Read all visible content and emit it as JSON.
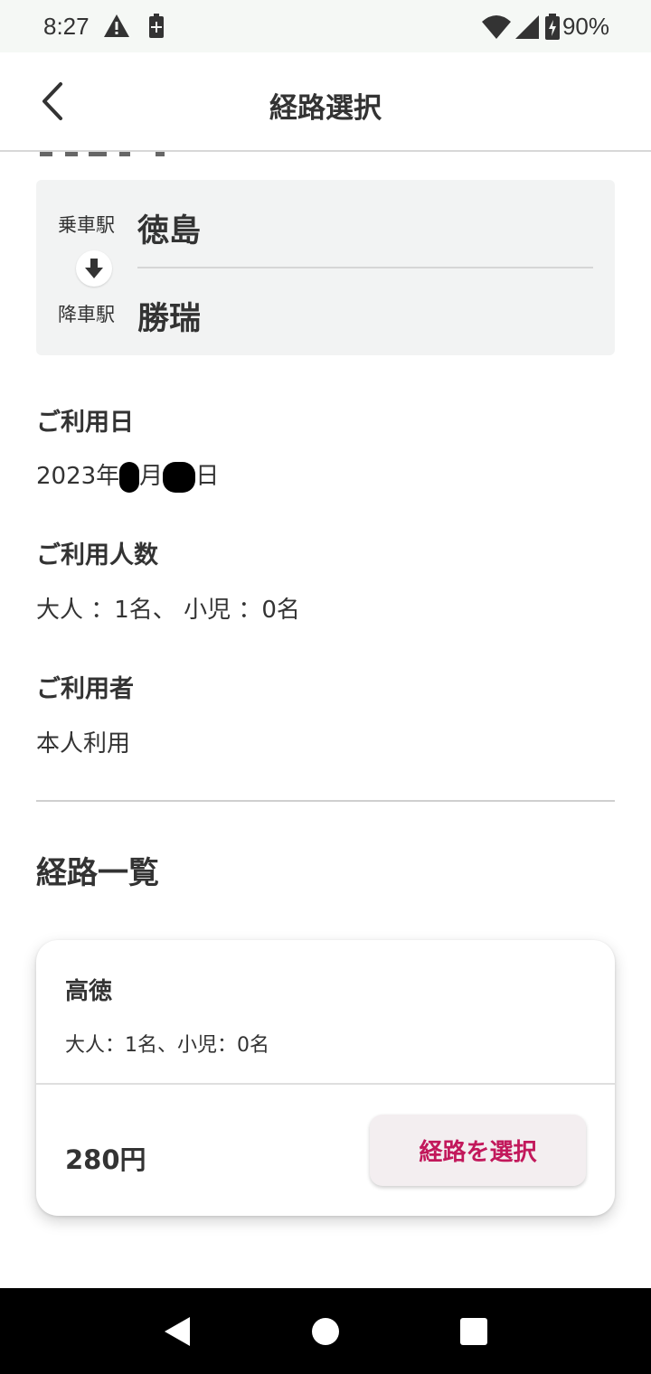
{
  "status_bar": {
    "time": "8:27",
    "battery_percent": "90%",
    "icons": [
      "warning-icon",
      "battery-saver-icon",
      "wifi-icon",
      "cell-signal-icon",
      "battery-charging-icon"
    ]
  },
  "app_bar": {
    "title": "経路選択",
    "back_icon": "chevron-left-icon"
  },
  "stations": {
    "boarding_label": "乗車駅",
    "boarding_name": "徳島",
    "alighting_label": "降車駅",
    "alighting_name": "勝瑞",
    "arrow_icon": "arrow-down-icon"
  },
  "usage_date": {
    "title": "ご利用日",
    "year_text": "2023年",
    "month_suffix": "月",
    "day_suffix": "日"
  },
  "passengers": {
    "title": "ご利用人数",
    "value": "大人 ：1名、 小児 ：0名"
  },
  "user": {
    "title": "ご利用者",
    "value": "本人利用"
  },
  "route_list": {
    "title": "経路一覧",
    "routes": [
      {
        "name": "高徳",
        "passengers": "大人：1名、小児：0名",
        "price": "280円",
        "select_label": "経路を選択"
      }
    ]
  },
  "nav_bar": {
    "icons": [
      "back-triangle-icon",
      "home-circle-icon",
      "recents-square-icon"
    ]
  },
  "colors": {
    "accent": "#c2185b",
    "card_bg": "#f2f3f3",
    "button_bg": "#f3eef0",
    "text": "#333333"
  }
}
